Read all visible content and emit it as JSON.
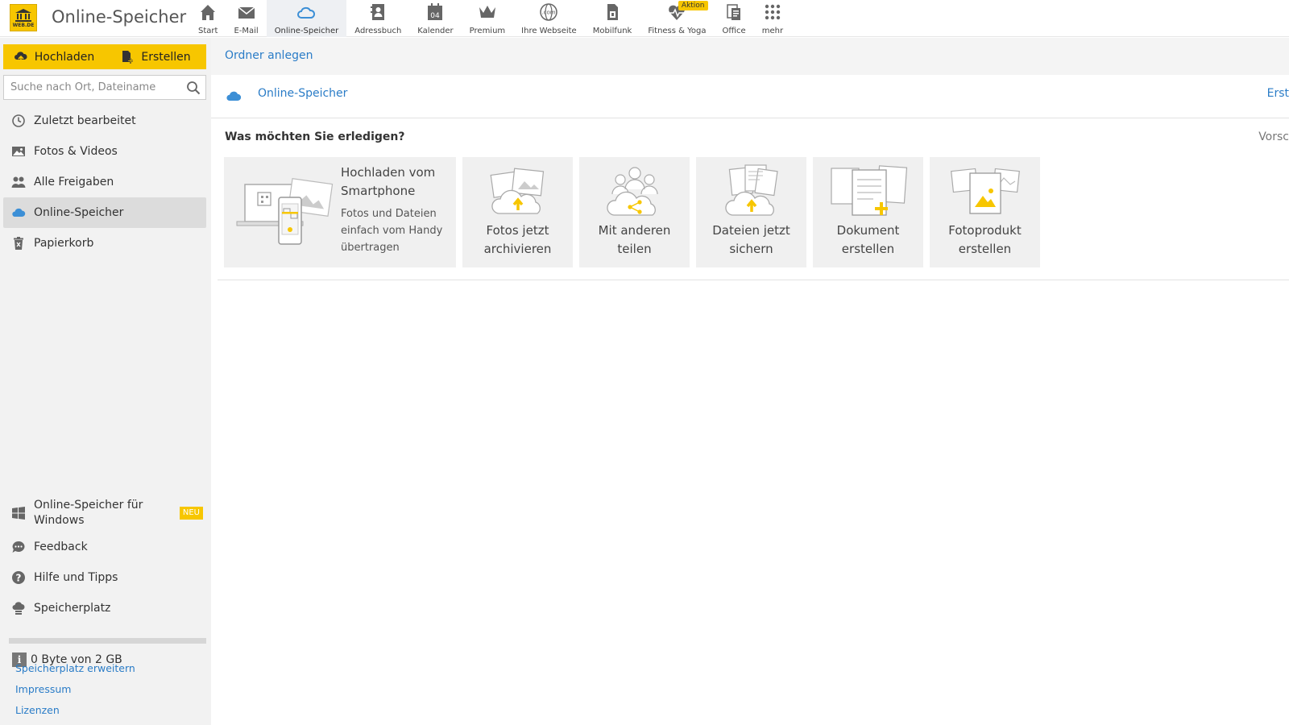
{
  "app": {
    "logo_text": "WEB.DE",
    "title": "Online-Speicher"
  },
  "nav": [
    {
      "label": "Start",
      "icon": "home-icon"
    },
    {
      "label": "E-Mail",
      "icon": "mail-icon"
    },
    {
      "label": "Online-Speicher",
      "icon": "cloud-icon",
      "active": true
    },
    {
      "label": "Adressbuch",
      "icon": "addressbook-icon"
    },
    {
      "label": "Kalender",
      "icon": "calendar-icon",
      "day": "04"
    },
    {
      "label": "Premium",
      "icon": "crown-icon"
    },
    {
      "label": "Ihre Webseite",
      "icon": "globe-icon",
      "globe_text": ".com"
    },
    {
      "label": "Mobilfunk",
      "icon": "sim-card-icon"
    },
    {
      "label": "Fitness & Yoga",
      "icon": "heartbeat-icon",
      "badge": "Aktion"
    },
    {
      "label": "Office",
      "icon": "office-icon"
    },
    {
      "label": "mehr",
      "icon": "grid-icon"
    }
  ],
  "sidebar": {
    "upload_label": "Hochladen",
    "create_label": "Erstellen",
    "search_placeholder": "Suche nach Ort, Dateiname",
    "items": [
      {
        "label": "Zuletzt bearbeitet",
        "icon": "clock-icon"
      },
      {
        "label": "Fotos & Videos",
        "icon": "image-icon"
      },
      {
        "label": "Alle Freigaben",
        "icon": "people-icon"
      },
      {
        "label": "Online-Speicher",
        "icon": "cloud-icon",
        "active": true
      },
      {
        "label": "Papierkorb",
        "icon": "trash-icon"
      }
    ],
    "bottom_items": [
      {
        "label": "Online-Speicher für Windows",
        "icon": "windows-icon",
        "badge": "NEU"
      },
      {
        "label": "Feedback",
        "icon": "chat-bubble-icon"
      },
      {
        "label": "Hilfe und Tipps",
        "icon": "question-icon"
      },
      {
        "label": "Speicherplatz",
        "icon": "storage-cloud-icon"
      }
    ],
    "storage": {
      "used_fraction": 0,
      "info_glyph": "i",
      "text": "0 Byte von 2 GB"
    },
    "links": [
      "Speicherplatz erweitern",
      "Impressum",
      "Lizenzen"
    ]
  },
  "main": {
    "toolbar_link": "Ordner anlegen",
    "breadcrumb": "Online-Speicher",
    "breadcrumb_right": "Erst",
    "section_title": "Was möchten Sie erledigen?",
    "section_right": "Vorsc",
    "tiles": {
      "wide": {
        "title": "Hochladen vom Smartphone",
        "desc": "Fotos und Dateien einfach vom Handy übertragen"
      },
      "small": [
        {
          "label": "Fotos jetzt archivieren",
          "icon": "photo-archive-icon"
        },
        {
          "label": "Mit anderen teilen",
          "icon": "share-people-icon"
        },
        {
          "label": "Dateien jetzt sichern",
          "icon": "file-backup-icon"
        },
        {
          "label": "Dokument erstellen",
          "icon": "document-create-icon"
        },
        {
          "label": "Fotoprodukt erstellen",
          "icon": "photo-product-icon"
        }
      ]
    }
  },
  "colors": {
    "accent": "#f7c600",
    "link": "#2a7cc7",
    "sidebar_bg": "#f2f2f2",
    "cloud_blue": "#3c8fd6"
  }
}
